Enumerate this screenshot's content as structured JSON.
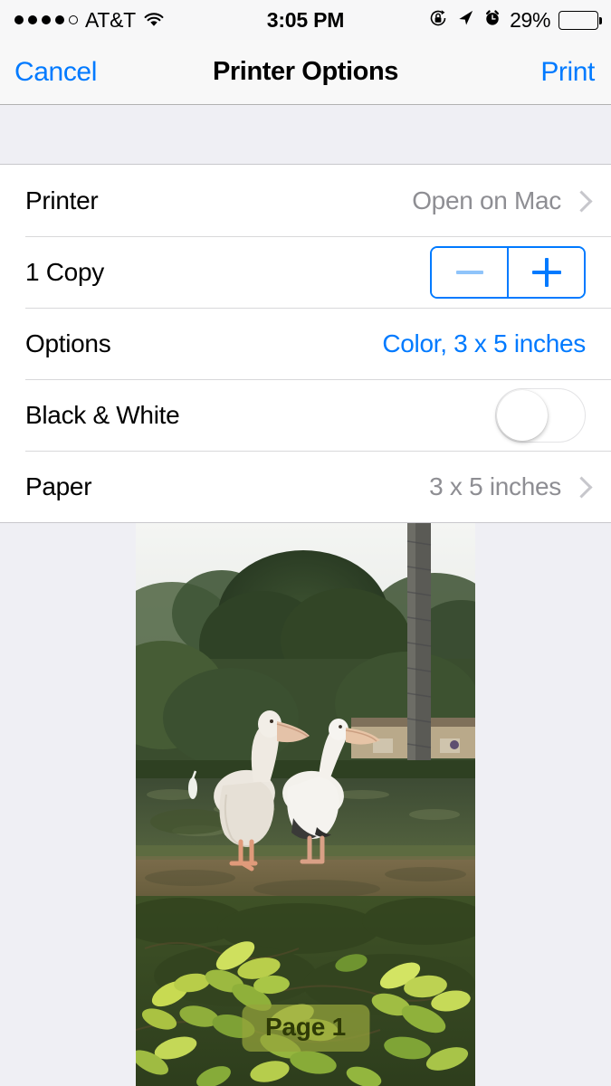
{
  "status_bar": {
    "signal_dots_filled": 4,
    "signal_dots_total": 5,
    "carrier": "AT&T",
    "wifi_icon": "wifi-icon",
    "time": "3:05 PM",
    "rotation_lock_icon": "rotation-lock-icon",
    "location_icon": "location-arrow-icon",
    "alarm_icon": "alarm-clock-icon",
    "battery_percent": "29%",
    "battery_level": 29,
    "battery_color": "#FCC81E"
  },
  "nav_bar": {
    "cancel_label": "Cancel",
    "title": "Printer Options",
    "print_label": "Print",
    "tint_color": "#007AFF"
  },
  "settings": {
    "rows": [
      {
        "label": "Printer",
        "value": "Open on Mac",
        "value_style": "gray",
        "accessory": "chevron"
      },
      {
        "label": "1 Copy",
        "value": "",
        "value_style": "none",
        "accessory": "stepper"
      },
      {
        "label": "Options",
        "value": "Color, 3 x 5 inches",
        "value_style": "blue",
        "accessory": "none"
      },
      {
        "label": "Black & White",
        "value": "",
        "value_style": "none",
        "accessory": "toggle"
      },
      {
        "label": "Paper",
        "value": "3 x 5 inches",
        "value_style": "gray",
        "accessory": "chevron"
      }
    ],
    "stepper": {
      "decrement_label": "−",
      "increment_label": "+",
      "decrement_enabled": false,
      "increment_enabled": true
    },
    "toggle": {
      "name": "black-and-white-toggle",
      "state": "off"
    }
  },
  "preview": {
    "page_badge": "Page 1",
    "photo_description": "two white pelicans by a pond with trees and foliage"
  },
  "colors": {
    "accent": "#007AFF",
    "group_background": "#EFEFF4",
    "cell_background": "#FFFFFF",
    "separator": "#D8D8DA",
    "secondary_text": "#8E8E93"
  }
}
